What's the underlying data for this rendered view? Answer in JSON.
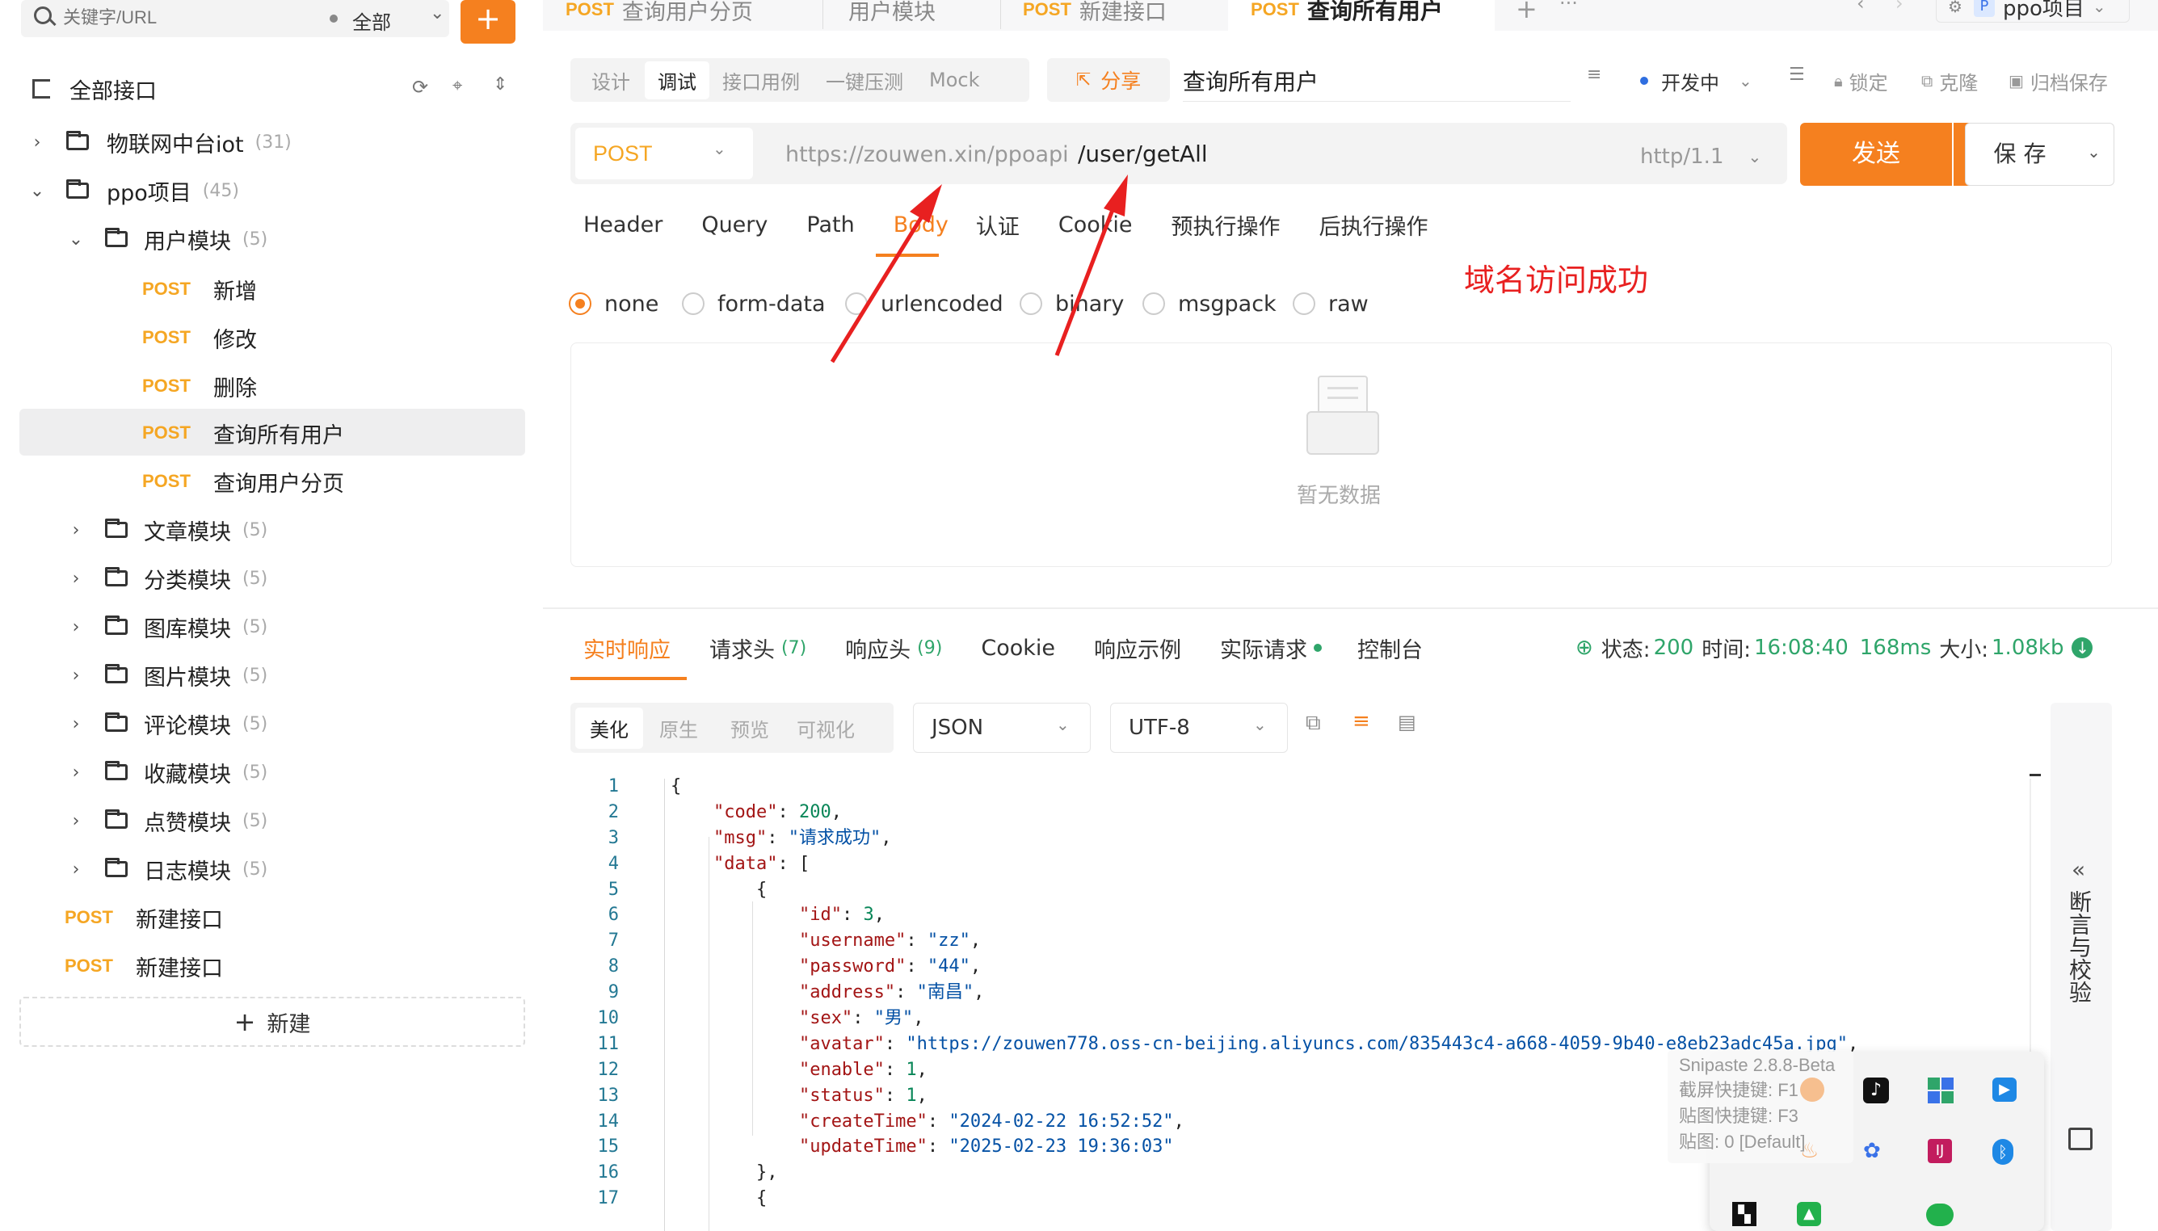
{
  "sidebar": {
    "search_placeholder": "关键字/URL",
    "filter_label": "全部",
    "add_label": "+",
    "all_apis": "全部接口",
    "tree": [
      {
        "label": "物联网中台iot",
        "count": "(31)",
        "level": 0,
        "expanded": false
      },
      {
        "label": "ppo项目",
        "count": "(45)",
        "level": 0,
        "expanded": true
      },
      {
        "label": "用户模块",
        "count": "(5)",
        "level": 1,
        "expanded": true
      }
    ],
    "user_apis": [
      {
        "method": "POST",
        "name": "新增"
      },
      {
        "method": "POST",
        "name": "修改"
      },
      {
        "method": "POST",
        "name": "删除"
      },
      {
        "method": "POST",
        "name": "查询所有用户"
      },
      {
        "method": "POST",
        "name": "查询用户分页"
      }
    ],
    "modules": [
      {
        "label": "文章模块",
        "count": "(5)"
      },
      {
        "label": "分类模块",
        "count": "(5)"
      },
      {
        "label": "图库模块",
        "count": "(5)"
      },
      {
        "label": "图片模块",
        "count": "(5)"
      },
      {
        "label": "评论模块",
        "count": "(5)"
      },
      {
        "label": "收藏模块",
        "count": "(5)"
      },
      {
        "label": "点赞模块",
        "count": "(5)"
      },
      {
        "label": "日志模块",
        "count": "(5)"
      }
    ],
    "root_apis": [
      {
        "method": "POST",
        "name": "新建接口"
      },
      {
        "method": "POST",
        "name": "新建接口"
      }
    ],
    "new_label": "新建"
  },
  "top_tabs": [
    {
      "method": "POST",
      "name": "查询用户分页"
    },
    {
      "method": "",
      "name": "用户模块"
    },
    {
      "method": "POST",
      "name": "新建接口"
    },
    {
      "method": "POST",
      "name": "查询所有用户"
    }
  ],
  "top_right": {
    "plus": "+",
    "more": "···",
    "project": "ppo项目",
    "project_badge": "P"
  },
  "mode_tabs": [
    "设计",
    "调试",
    "接口用例",
    "一键压测",
    "Mock"
  ],
  "share_label": "分享",
  "api_name": "查询所有用户",
  "toolbar_right": {
    "env": "开发中",
    "lock": "锁定",
    "clone": "克隆",
    "archive": "归档保存"
  },
  "request": {
    "method": "POST",
    "base_url": "https://zouwen.xin/ppoapi",
    "path": "/user/getAll",
    "protocol": "http/1.1",
    "send": "发送",
    "save": "保 存"
  },
  "param_tabs": [
    "Header",
    "Query",
    "Path",
    "Body",
    "认证",
    "Cookie",
    "预执行操作",
    "后执行操作"
  ],
  "body_types": [
    "none",
    "form-data",
    "urlencoded",
    "binary",
    "msgpack",
    "raw"
  ],
  "annotation": "域名访问成功",
  "empty_text": "暂无数据",
  "response_tabs": [
    {
      "label": "实时响应",
      "count": ""
    },
    {
      "label": "请求头",
      "count": "(7)"
    },
    {
      "label": "响应头",
      "count": "(9)"
    },
    {
      "label": "Cookie",
      "count": ""
    },
    {
      "label": "响应示例",
      "count": ""
    },
    {
      "label": "实际请求",
      "count": ""
    },
    {
      "label": "控制台",
      "count": ""
    }
  ],
  "status": {
    "status_label": "状态:",
    "status_value": "200",
    "time_label": "时间:",
    "time_value": "16:08:40",
    "duration": "168ms",
    "size_label": "大小:",
    "size_value": "1.08kb"
  },
  "view_tabs": [
    "美化",
    "原生",
    "预览",
    "可视化"
  ],
  "format_select": "JSON",
  "encoding_select": "UTF-8",
  "side_panel": {
    "label": "断言与校验"
  },
  "code_lines": [
    [
      {
        "t": "p",
        "v": "{"
      }
    ],
    [
      {
        "t": "p",
        "v": "    "
      },
      {
        "t": "k",
        "v": "\"code\""
      },
      {
        "t": "p",
        "v": ": "
      },
      {
        "t": "n",
        "v": "200"
      },
      {
        "t": "p",
        "v": ","
      }
    ],
    [
      {
        "t": "p",
        "v": "    "
      },
      {
        "t": "k",
        "v": "\"msg\""
      },
      {
        "t": "p",
        "v": ": "
      },
      {
        "t": "s",
        "v": "\"请求成功\""
      },
      {
        "t": "p",
        "v": ","
      }
    ],
    [
      {
        "t": "p",
        "v": "    "
      },
      {
        "t": "k",
        "v": "\"data\""
      },
      {
        "t": "p",
        "v": ": ["
      }
    ],
    [
      {
        "t": "p",
        "v": "        {"
      }
    ],
    [
      {
        "t": "p",
        "v": "            "
      },
      {
        "t": "k",
        "v": "\"id\""
      },
      {
        "t": "p",
        "v": ": "
      },
      {
        "t": "n",
        "v": "3"
      },
      {
        "t": "p",
        "v": ","
      }
    ],
    [
      {
        "t": "p",
        "v": "            "
      },
      {
        "t": "k",
        "v": "\"username\""
      },
      {
        "t": "p",
        "v": ": "
      },
      {
        "t": "s",
        "v": "\"zz\""
      },
      {
        "t": "p",
        "v": ","
      }
    ],
    [
      {
        "t": "p",
        "v": "            "
      },
      {
        "t": "k",
        "v": "\"password\""
      },
      {
        "t": "p",
        "v": ": "
      },
      {
        "t": "s",
        "v": "\"44\""
      },
      {
        "t": "p",
        "v": ","
      }
    ],
    [
      {
        "t": "p",
        "v": "            "
      },
      {
        "t": "k",
        "v": "\"address\""
      },
      {
        "t": "p",
        "v": ": "
      },
      {
        "t": "s",
        "v": "\"南昌\""
      },
      {
        "t": "p",
        "v": ","
      }
    ],
    [
      {
        "t": "p",
        "v": "            "
      },
      {
        "t": "k",
        "v": "\"sex\""
      },
      {
        "t": "p",
        "v": ": "
      },
      {
        "t": "s",
        "v": "\"男\""
      },
      {
        "t": "p",
        "v": ","
      }
    ],
    [
      {
        "t": "p",
        "v": "            "
      },
      {
        "t": "k",
        "v": "\"avatar\""
      },
      {
        "t": "p",
        "v": ": "
      },
      {
        "t": "s",
        "v": "\"https://zouwen778.oss-cn-beijing.aliyuncs.com/835443c4-a668-4059-9b40-e8eb23adc45a.jpg\""
      },
      {
        "t": "p",
        "v": ","
      }
    ],
    [
      {
        "t": "p",
        "v": "            "
      },
      {
        "t": "k",
        "v": "\"enable\""
      },
      {
        "t": "p",
        "v": ": "
      },
      {
        "t": "n",
        "v": "1"
      },
      {
        "t": "p",
        "v": ","
      }
    ],
    [
      {
        "t": "p",
        "v": "            "
      },
      {
        "t": "k",
        "v": "\"status\""
      },
      {
        "t": "p",
        "v": ": "
      },
      {
        "t": "n",
        "v": "1"
      },
      {
        "t": "p",
        "v": ","
      }
    ],
    [
      {
        "t": "p",
        "v": "            "
      },
      {
        "t": "k",
        "v": "\"createTime\""
      },
      {
        "t": "p",
        "v": ": "
      },
      {
        "t": "s",
        "v": "\"2024-02-22 16:52:52\""
      },
      {
        "t": "p",
        "v": ","
      }
    ],
    [
      {
        "t": "p",
        "v": "            "
      },
      {
        "t": "k",
        "v": "\"updateTime\""
      },
      {
        "t": "p",
        "v": ": "
      },
      {
        "t": "s",
        "v": "\"2025-02-23 19:36:03\""
      }
    ],
    [
      {
        "t": "p",
        "v": "        },"
      }
    ],
    [
      {
        "t": "p",
        "v": "        {"
      }
    ]
  ],
  "snipaste": {
    "title": "Snipaste 2.8.8-Beta",
    "lines": [
      "截屏快捷键: F1",
      "贴图快捷键: F3",
      "贴图: 0 [Default]"
    ]
  },
  "colors": {
    "accent": "#f5801f",
    "method_post": "#f5a623",
    "status_green": "#2fa56a",
    "arrow": "#e82020"
  }
}
